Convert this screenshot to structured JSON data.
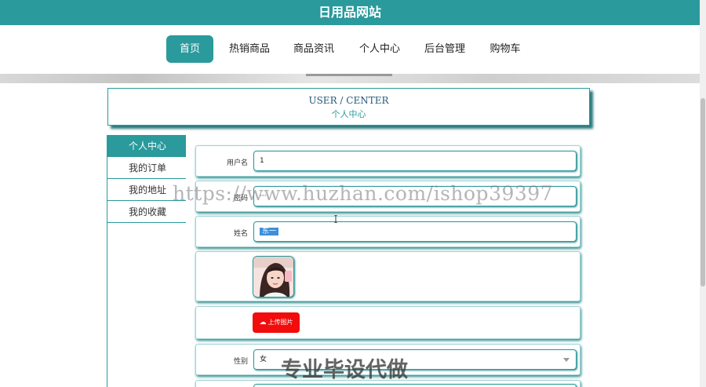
{
  "site_title": "日用品网站",
  "nav": {
    "items": [
      "首页",
      "热销商品",
      "商品资讯",
      "个人中心",
      "后台管理",
      "购物车"
    ],
    "active_index": 0
  },
  "section": {
    "title_en": "USER / CENTER",
    "title_zh": "个人中心"
  },
  "sidebar": {
    "items": [
      "个人中心",
      "我的订单",
      "我的地址",
      "我的收藏"
    ],
    "active_index": 0
  },
  "form": {
    "username": {
      "label": "用户名",
      "value": "1"
    },
    "password": {
      "label": "密码",
      "value": "···"
    },
    "name": {
      "label": "姓名",
      "value": "东一"
    },
    "upload": {
      "label": "上传图片"
    },
    "gender": {
      "label": "性别",
      "value": "女"
    }
  },
  "watermark": {
    "url": "https://www.huzhan.com/ishop39397",
    "ad": "专业毕设代做"
  },
  "colors": {
    "theme": "#2a9a9c",
    "upload_button": "#f20c0c",
    "selection": "#3d8fdc"
  },
  "icons": {
    "upload": "cloud-upload-icon",
    "select": "chevron-down-icon"
  }
}
